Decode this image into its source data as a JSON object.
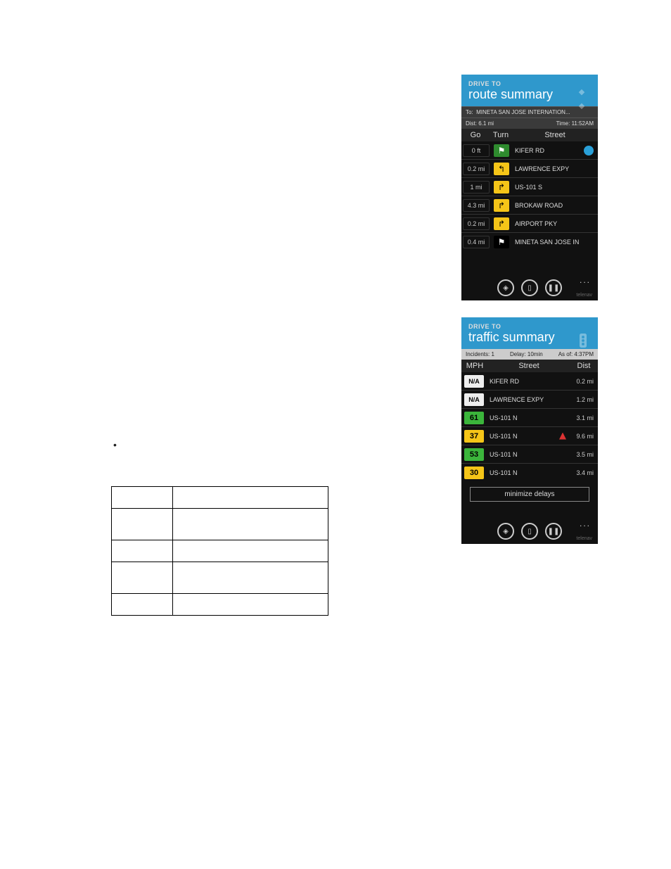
{
  "bullet": "•",
  "route": {
    "drive_to": "DRIVE TO",
    "title": "route summary",
    "to_label": "To:",
    "to_value": "MINETA SAN JOSE INTERNATION...",
    "dist_label": "Dist:",
    "dist_value": "6.1 mi",
    "time_label": "Time:",
    "time_value": "11:52AM",
    "cols": {
      "go": "Go",
      "turn": "Turn",
      "street": "Street"
    },
    "rows": [
      {
        "go": "0 ft",
        "turn": "⚑",
        "style": "green",
        "street": "KIFER RD",
        "badge": true
      },
      {
        "go": "0.2 mi",
        "turn": "↰",
        "style": "yellow",
        "street": "LAWRENCE EXPY"
      },
      {
        "go": "1 mi",
        "turn": "↱",
        "style": "yellow",
        "street": "US-101 S"
      },
      {
        "go": "4.3 mi",
        "turn": "↱",
        "style": "yellow",
        "street": "BROKAW ROAD"
      },
      {
        "go": "0.2 mi",
        "turn": "↱",
        "style": "yellow",
        "street": "AIRPORT PKY"
      },
      {
        "go": "0.4 mi",
        "turn": "⚑",
        "style": "flag",
        "street": "MINETA SAN JOSE IN"
      }
    ]
  },
  "traffic": {
    "drive_to": "DRIVE TO",
    "title": "traffic summary",
    "incidents_label": "Incidents:",
    "incidents": "1",
    "delay_label": "Delay:",
    "delay": "10min",
    "asof_label": "As of:",
    "asof": "4:37PM",
    "cols": {
      "mph": "MPH",
      "street": "Street",
      "dist": "Dist"
    },
    "rows": [
      {
        "mph": "N/A",
        "style": "na",
        "street": "KIFER RD",
        "dist": "0.2 mi"
      },
      {
        "mph": "N/A",
        "style": "na",
        "street": "LAWRENCE EXPY",
        "dist": "1.2 mi"
      },
      {
        "mph": "61",
        "style": "green",
        "street": "US-101 N",
        "dist": "3.1 mi"
      },
      {
        "mph": "37",
        "style": "yellow",
        "street": "US-101 N",
        "dist": "9.6 mi",
        "alert": true
      },
      {
        "mph": "53",
        "style": "green",
        "street": "US-101 N",
        "dist": "3.5 mi"
      },
      {
        "mph": "30",
        "style": "yellow",
        "street": "US-101 N",
        "dist": "3.4 mi"
      }
    ],
    "minimize": "minimize delays"
  },
  "brand": "telenav",
  "dots": "..."
}
